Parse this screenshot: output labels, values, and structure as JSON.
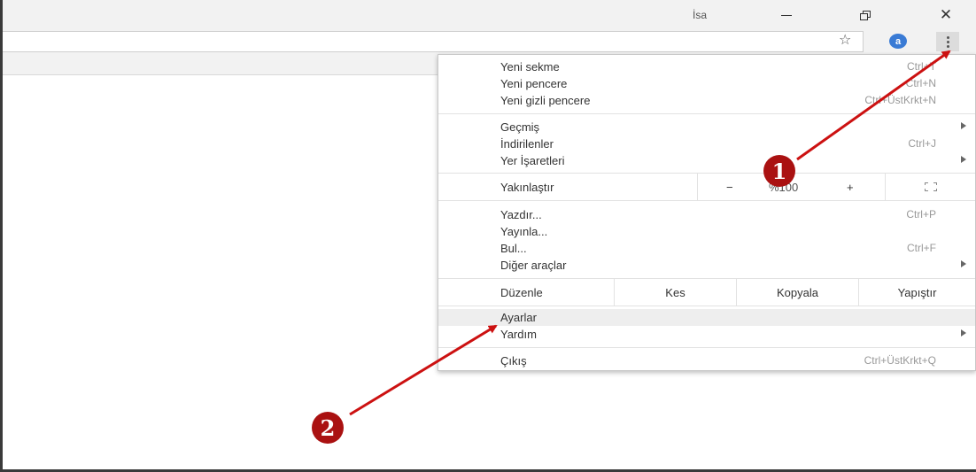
{
  "window": {
    "profile_name": "İsa",
    "minimize_glyph": "—",
    "close_glyph": "✕"
  },
  "toolbar": {
    "star_glyph": "☆",
    "extension_glyph": "a"
  },
  "menu": {
    "group1": [
      {
        "label": "Yeni sekme",
        "shortcut": "Ctrl+T"
      },
      {
        "label": "Yeni pencere",
        "shortcut": "Ctrl+N"
      },
      {
        "label": "Yeni gizli pencere",
        "shortcut": "Ctrl+ÜstKrkt+N"
      }
    ],
    "group2": [
      {
        "label": "Geçmiş",
        "shortcut": ""
      },
      {
        "label": "İndirilenler",
        "shortcut": "Ctrl+J"
      },
      {
        "label": "Yer İşaretleri",
        "shortcut": ""
      }
    ],
    "zoom": {
      "label": "Yakınlaştır",
      "minus": "−",
      "value": "%100",
      "plus": "+"
    },
    "group3": [
      {
        "label": "Yazdır...",
        "shortcut": "Ctrl+P"
      },
      {
        "label": "Yayınla...",
        "shortcut": ""
      },
      {
        "label": "Bul...",
        "shortcut": "Ctrl+F"
      },
      {
        "label": "Diğer araçlar",
        "shortcut": ""
      }
    ],
    "edit": {
      "label": "Düzenle",
      "cut": "Kes",
      "copy": "Kopyala",
      "paste": "Yapıştır"
    },
    "group4": [
      {
        "label": "Ayarlar"
      },
      {
        "label": "Yardım"
      }
    ],
    "exit": {
      "label": "Çıkış",
      "shortcut": "Ctrl+ÜstKrkt+Q"
    }
  },
  "annotations": {
    "badge1": "1",
    "badge2": "2",
    "arrow_color": "#cc1111",
    "badge_color": "#aa1111"
  }
}
